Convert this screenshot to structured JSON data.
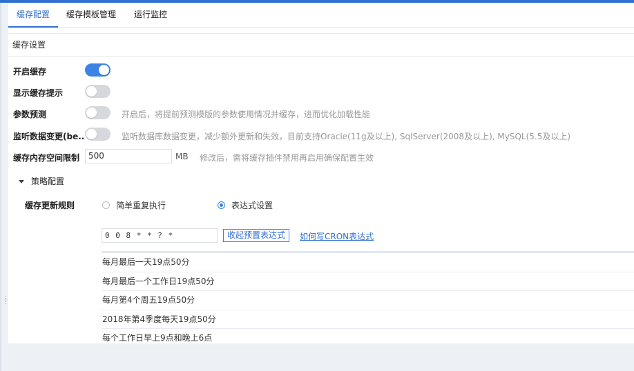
{
  "tabs": [
    {
      "label": "缓存配置",
      "active": true
    },
    {
      "label": "缓存模板管理",
      "active": false
    },
    {
      "label": "运行监控",
      "active": false
    }
  ],
  "section": {
    "title": "缓存设置"
  },
  "settings": {
    "enable_cache": {
      "label": "开启缓存",
      "on": true
    },
    "show_hint": {
      "label": "显示缓存提示",
      "on": false
    },
    "param_predict": {
      "label": "参数预测",
      "on": false,
      "hint": "开启后，将提前预测模版的参数使用情况并缓存，进而优化加载性能"
    },
    "listen_db": {
      "label": "监听数据变更(be...",
      "on": false,
      "hint": "监听数据库数据变更，减少额外更新和失效，目前支持Oracle(11g及以上), SqlServer(2008及以上), MySQL(5.5及以上)"
    },
    "memory_limit": {
      "label": "缓存内存空间限制",
      "value": "500",
      "unit": "MB",
      "hint": "修改后，需将缓存插件禁用再启用确保配置生效"
    }
  },
  "strategy": {
    "title": "策略配置",
    "rule_label": "缓存更新规则",
    "options": [
      {
        "label": "简单重复执行",
        "checked": false
      },
      {
        "label": "表达式设置",
        "checked": true
      }
    ],
    "cron_value": "0 0 8 * * ? *",
    "collapse_label": "收起预置表达式",
    "cron_link": "如何写CRON表达式",
    "presets": [
      "每月最后一天19点50分",
      "每月最后一个工作日19点50分",
      "每月第4个周五19点50分",
      "2018年第4季度每天19点50分",
      "每个工作日早上9点和晚上6点"
    ]
  },
  "colors": {
    "accent": "#2f6fcf",
    "toggle_on": "#3b84e6",
    "toggle_off": "#d5d8dc"
  }
}
